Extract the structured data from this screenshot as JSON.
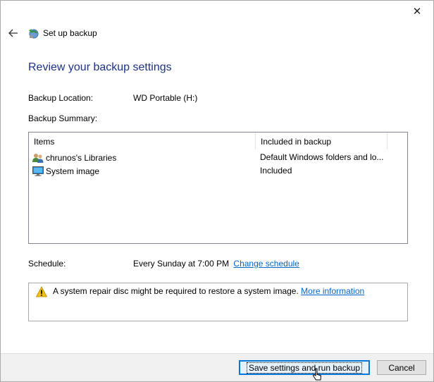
{
  "window": {
    "close_glyph": "✕"
  },
  "nav": {
    "back_icon": "arrow-left-icon",
    "app_icon": "backup-icon",
    "title": "Set up backup"
  },
  "heading": "Review your backup settings",
  "backup_location": {
    "label": "Backup Location:",
    "value": "WD Portable (H:)"
  },
  "backup_summary": {
    "label": "Backup Summary:"
  },
  "list": {
    "columns": [
      "Items",
      "Included in backup"
    ],
    "rows": [
      {
        "icon": "users-icon",
        "item": "chrunos's Libraries",
        "included": "Default Windows folders and lo..."
      },
      {
        "icon": "monitor-icon",
        "item": "System image",
        "included": "Included"
      }
    ]
  },
  "schedule": {
    "label": "Schedule:",
    "value": "Every Sunday at 7:00 PM",
    "change_link": "Change schedule"
  },
  "info": {
    "icon": "warning-icon",
    "message": "A system repair disc might be required to restore a system image.",
    "link": "More information"
  },
  "footer": {
    "save_label": "Save settings and run backup",
    "cancel_label": "Cancel"
  },
  "colors": {
    "heading": "#1e3287",
    "link": "#0066cc",
    "primary_border": "#0078d7",
    "footer_bg": "#f0f0f0"
  }
}
